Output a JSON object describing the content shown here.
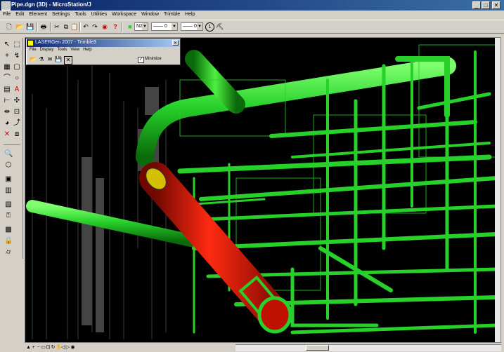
{
  "window": {
    "title": "Pipe.dgn (3D) - MicroStation/J"
  },
  "menubar": [
    "File",
    "Edit",
    "Element",
    "Settings",
    "Tools",
    "Utilities",
    "Workspace",
    "Window",
    "Trimble",
    "Help"
  ],
  "toolbar": {
    "level_value": "N2",
    "line_style_value": "0",
    "weight_value": "0",
    "count_value": "1"
  },
  "lasergen": {
    "title": "LASERGen 2007 - Trimble3",
    "menu": [
      "File",
      "Display",
      "Tools",
      "View",
      "Help"
    ],
    "minimize_label": "Minimize",
    "minimize_checked": true
  },
  "colors": {
    "pipe_green": "#27d12a",
    "pipe_red": "#e0180c",
    "background": "#000000"
  },
  "icons": [
    "new-file-icon",
    "open-icon",
    "save-icon",
    "print-icon",
    "cut-icon",
    "copy-icon",
    "paste-icon",
    "undo-icon",
    "redo-icon",
    "render-icon",
    "help-icon"
  ]
}
